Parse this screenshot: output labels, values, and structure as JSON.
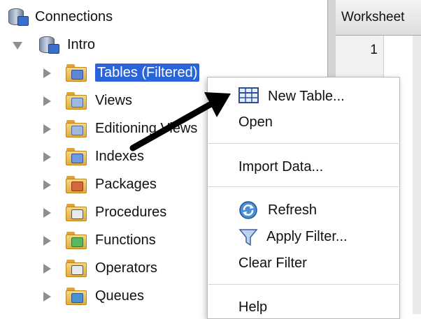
{
  "tree": {
    "root_label": "Connections",
    "connection_label": "Intro",
    "items": [
      {
        "label": "Tables (Filtered)",
        "selected": true,
        "icon": "table-folder-icon"
      },
      {
        "label": "Views",
        "icon": "views-folder-icon"
      },
      {
        "label": "Editioning Views",
        "icon": "editioning-views-folder-icon"
      },
      {
        "label": "Indexes",
        "icon": "indexes-folder-icon"
      },
      {
        "label": "Packages",
        "icon": "packages-folder-icon"
      },
      {
        "label": "Procedures",
        "icon": "procedures-folder-icon"
      },
      {
        "label": "Functions",
        "icon": "functions-folder-icon"
      },
      {
        "label": "Operators",
        "icon": "operators-folder-icon"
      },
      {
        "label": "Queues",
        "icon": "queues-folder-icon"
      }
    ]
  },
  "worksheet": {
    "tab_label": "Worksheet",
    "line_number": "1"
  },
  "context_menu": {
    "new_table": "New Table...",
    "open": "Open",
    "import_data": "Import Data...",
    "refresh": "Refresh",
    "apply_filter": "Apply Filter...",
    "clear_filter": "Clear Filter",
    "help": "Help"
  },
  "colors": {
    "selection": "#2b63d8",
    "menu_border": "#b8b8b8"
  }
}
